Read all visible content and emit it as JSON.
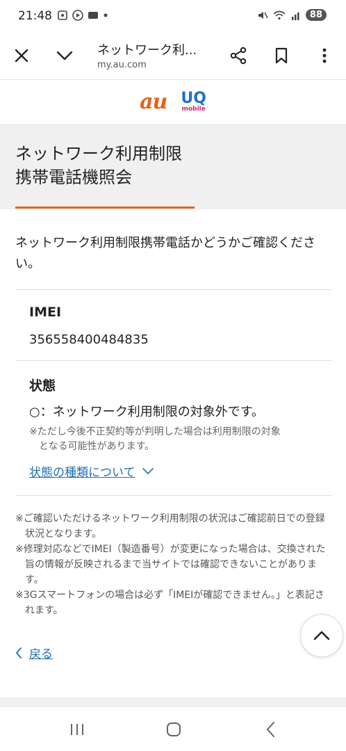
{
  "status_bar": {
    "time": "21:48",
    "battery": "88"
  },
  "browser": {
    "page_title": "ネットワーク利...",
    "url": "my.au.com"
  },
  "logos": {
    "au": "au",
    "uq": "UQ",
    "uq_sub": "mobile"
  },
  "page": {
    "title_line1": "ネットワーク利用制限",
    "title_line2": "携帯電話機照会",
    "intro": "ネットワーク利用制限携帯電話かどうかご確認ください。"
  },
  "imei": {
    "label": "IMEI",
    "value": "356558400484835"
  },
  "status": {
    "label": "状態",
    "value": "○：ネットワーク利用制限の対象外です。",
    "note_line1": "※ただし今後不正契約等が判明した場合は利用制限の対象",
    "note_line2": "となる可能性があります。",
    "types_link": "状態の種類について"
  },
  "footnotes": [
    "※ご確認いただけるネットワーク利用制限の状況はご確認前日での登録状況となります。",
    "※修理対応などでIMEI（製造番号）が変更になった場合は、交換された旨の情報が反映されるまで当サイトでは確認できないことがあります。",
    "※3Gスマートフォンの場合は必ず「IMEIが確認できません。」と表記されます。"
  ],
  "back_link": "戻る",
  "colors": {
    "accent": "#e8601b",
    "link": "#1f6db0",
    "uq_blue": "#1f72c4",
    "uq_pink": "#d6246e"
  },
  "icons": [
    "close-icon",
    "chevron-down-icon",
    "share-icon",
    "bookmark-icon",
    "more-vert-icon",
    "chevron-up-icon",
    "chevron-left-icon",
    "recents-icon",
    "home-icon",
    "back-icon"
  ]
}
